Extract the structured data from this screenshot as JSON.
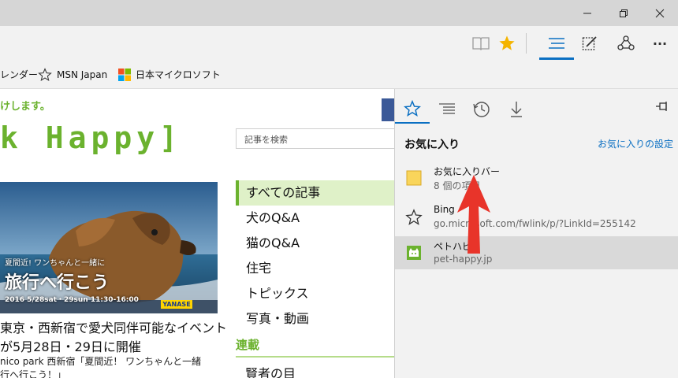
{
  "window": {
    "minimize_icon": "minimize-icon",
    "restore_icon": "restore-icon",
    "close_icon": "close-icon"
  },
  "toolbar": {
    "icons": [
      "reading-view-icon",
      "favorite-star-icon",
      "hub-icon",
      "web-note-icon",
      "share-icon",
      "more-icon"
    ],
    "more_label": "···"
  },
  "favbar": {
    "calendar_label": "レンダー",
    "msn_label": "MSN Japan",
    "microsoft_label": "日本マイクロソフト"
  },
  "page": {
    "announce": "けします。",
    "logo": "k Happy]",
    "search_placeholder": "記事を検索",
    "hero": {
      "line1": "夏間近! ワンちゃんと一緒に",
      "line2": "旅行へ行こう",
      "date": "2016 5/28sat・29sun 11:30-16:00",
      "sponsor": "YANASE"
    },
    "article_title": "東京・西新宿で愛犬同伴可能なイベントが5月28日・29日に開催",
    "article_sub_line1": "nico park 西新宿「夏間近！ ワンちゃんと一緒",
    "article_sub_line2": "行へ行こう！」",
    "categories": [
      "すべての記事",
      "犬のQ&A",
      "猫のQ&A",
      "住宅",
      "トピックス",
      "写真・動画"
    ],
    "series_heading": "連載",
    "series_first": "賢者の目"
  },
  "hub": {
    "tabs": [
      "favorites-tab",
      "reading-list-tab",
      "history-tab",
      "downloads-tab"
    ],
    "title": "お気に入り",
    "settings_link": "お気に入りの設定",
    "items": [
      {
        "name": "お気に入りバー",
        "detail": "8 個の項目",
        "icon": "folder-icon"
      },
      {
        "name": "Bing",
        "detail": "go.microsoft.com/fwlink/p/?LinkId=255142",
        "icon": "star-outline-icon"
      },
      {
        "name": "ペトハピ",
        "detail": "pet-happy.jp",
        "icon": "pethappy-favicon"
      }
    ]
  },
  "colors": {
    "accent_blue": "#0a6fc2",
    "site_green": "#6bb22e",
    "arrow_red": "#e8342a",
    "star_gold": "#f4b400"
  }
}
